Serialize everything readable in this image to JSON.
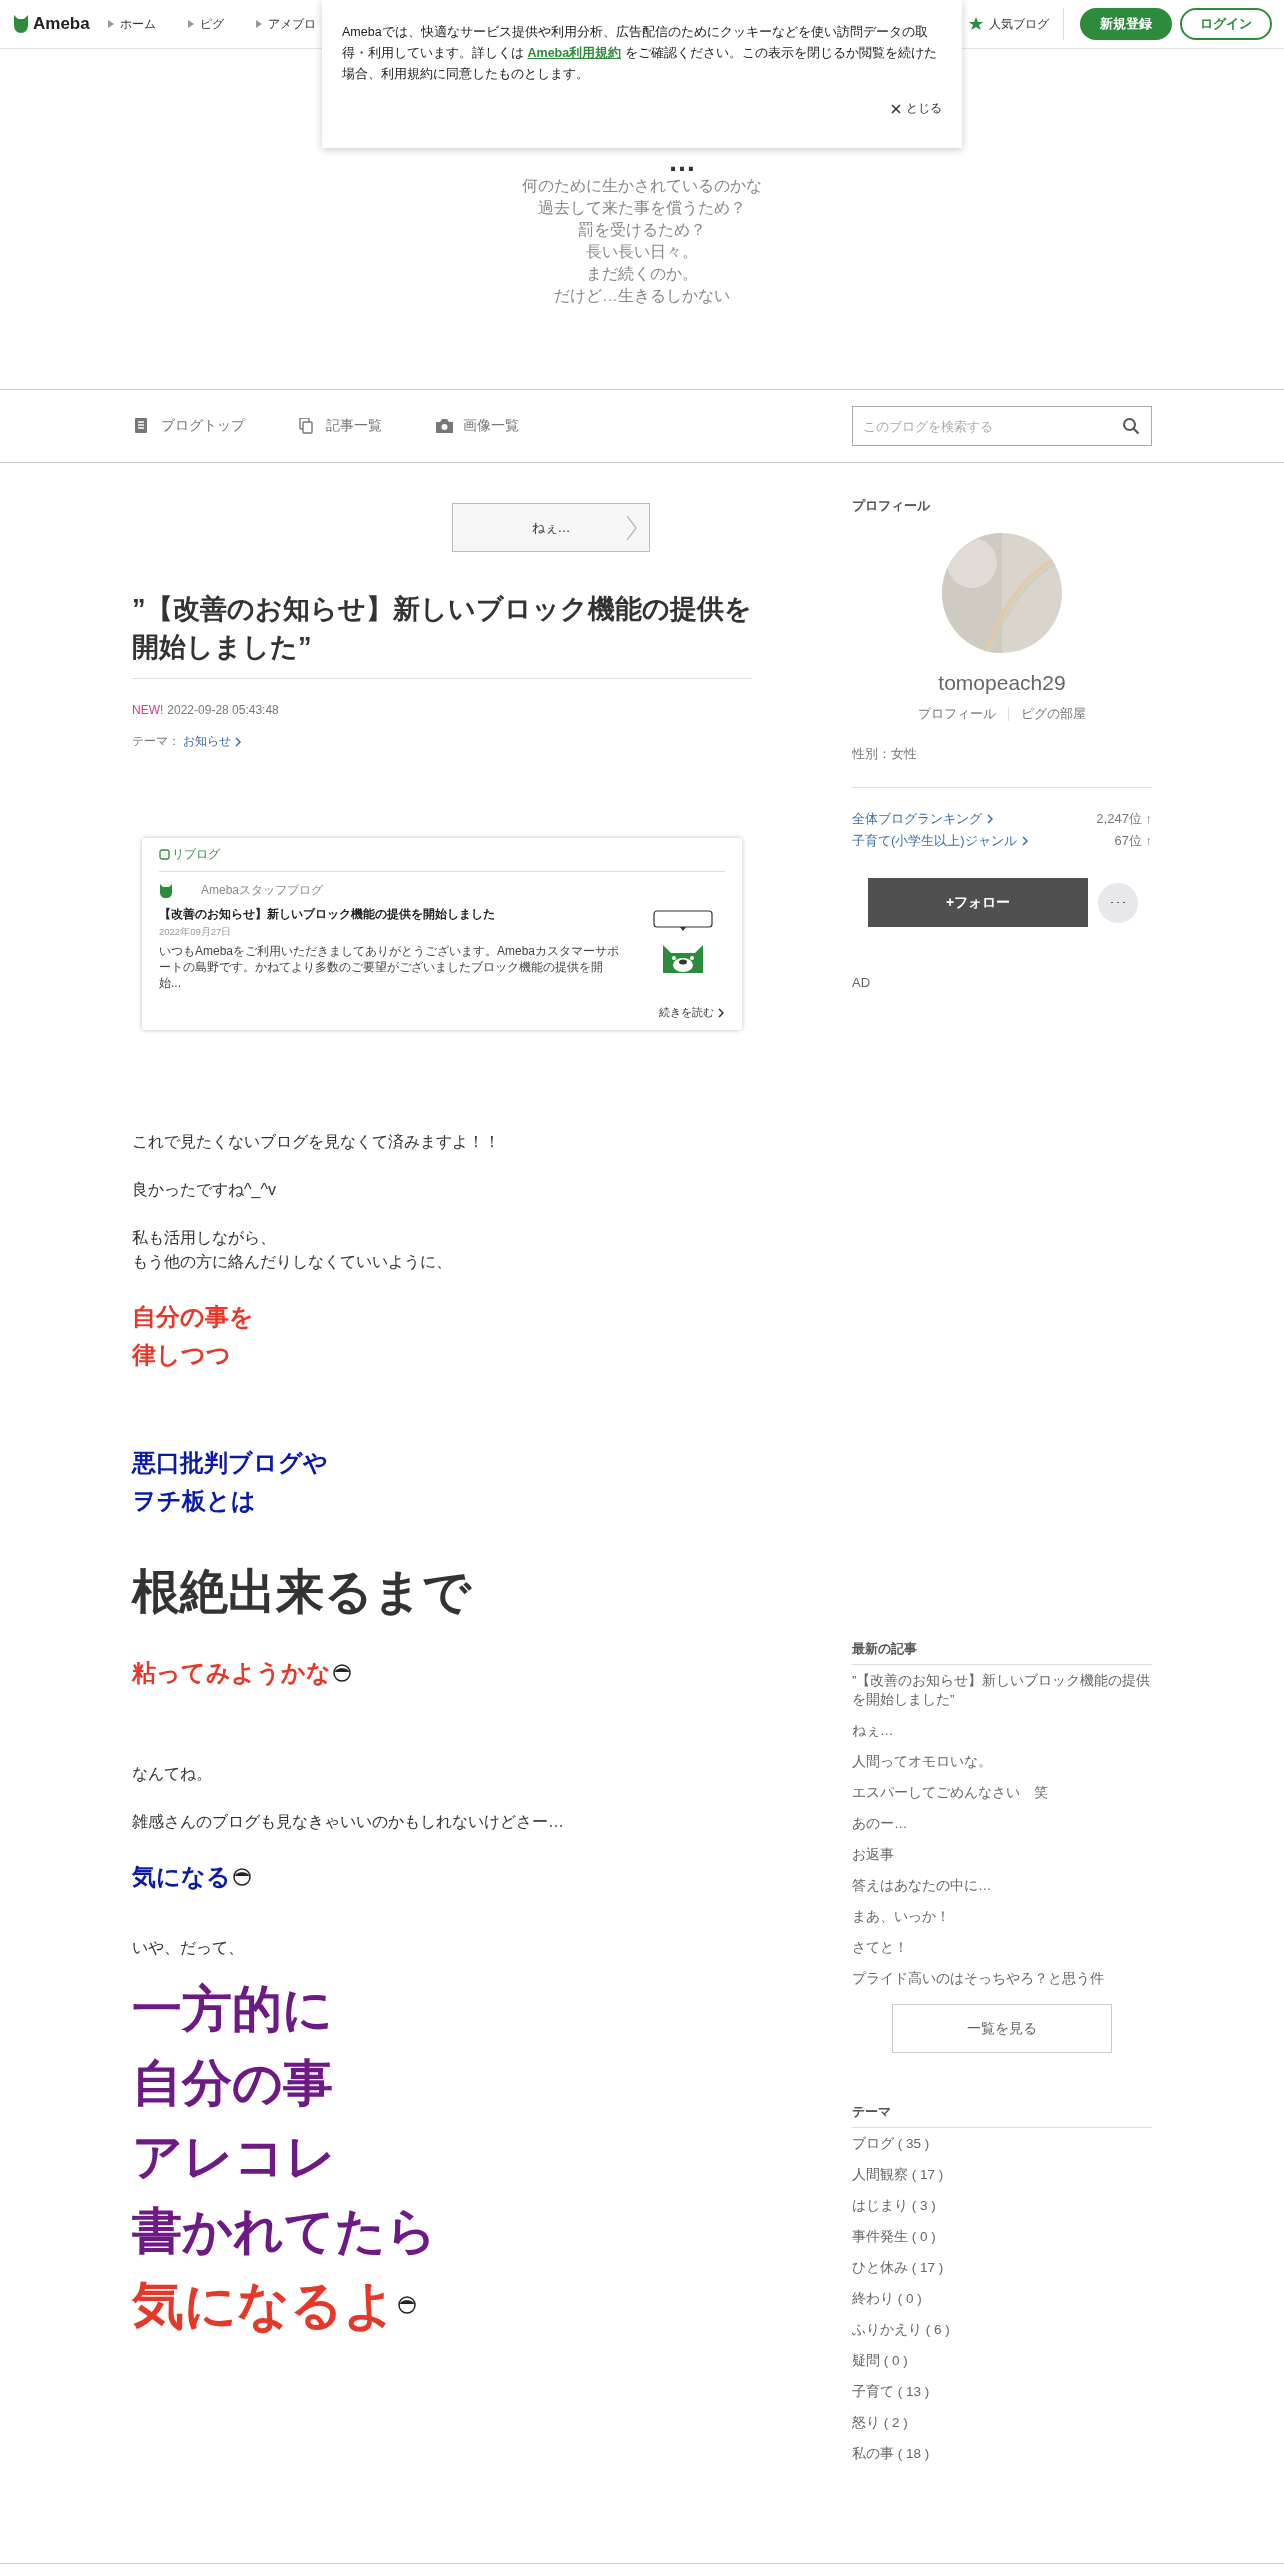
{
  "header": {
    "logo": "Ameba",
    "nav": [
      "ホーム",
      "ピグ",
      "アメブロ"
    ],
    "popular": "人気ブログ",
    "signup": "新規登録",
    "login": "ログイン"
  },
  "cookie_notice": {
    "text_before": "Amebaでは、快適なサービス提供や利用分析、広告配信のためにクッキーなどを使い訪問データの取得・利用しています。詳しくは",
    "link": "Ameba利用規約",
    "text_after": "をご確認ください。この表示を閉じるか閲覧を続けた場合、利用規約に同意したものとします。",
    "close": "とじる"
  },
  "blog": {
    "title": "…",
    "description": [
      "何のために生かされているのかな",
      "過去して来た事を償うため？",
      "罰を受けるため？",
      "長い長い日々。",
      "まだ続くのか。",
      "だけど…生きるしかない"
    ]
  },
  "blog_nav": [
    {
      "kind": "top",
      "label": "ブログトップ"
    },
    {
      "kind": "list",
      "label": "記事一覧"
    },
    {
      "kind": "images",
      "label": "画像一覧"
    }
  ],
  "search": {
    "placeholder": "このブログを検索する"
  },
  "article": {
    "prev": "ねぇ…",
    "title": "”【改善のお知らせ】新しいブロック機能の提供を開始しました”",
    "new_badge": "NEW!",
    "date": "2022-09-28 05:43:48",
    "theme_label": "テーマ：",
    "theme": "お知らせ",
    "reblog": {
      "label": "リブログ",
      "source": "Amebaスタッフブログ",
      "title": "【改善のお知らせ】新しいブロック機能の提供を開始しました",
      "date": "2022年09月27日",
      "excerpt": "いつもAmebaをご利用いただきましてありがとうございます。Amebaカスタマーサポートの島野です。かねてより多数のご要望がございましたブロック機能の提供を開始...",
      "more": "続きを読む"
    },
    "body": [
      {
        "kind": "text",
        "text": "これで見たくないブログを見なくて済みますよ！！"
      },
      {
        "kind": "text",
        "text": "良かったですね^_^v"
      },
      {
        "kind": "text",
        "lines": [
          "私も活用しながら、",
          "もう他の方に絡んだりしなくていいように、"
        ]
      },
      {
        "kind": "red",
        "lines": [
          "自分の事を",
          "律しつつ"
        ]
      },
      {
        "kind": "blue",
        "lines": [
          "悪口批判ブログや",
          "ヲチ板とは"
        ]
      },
      {
        "kind": "huge",
        "text": "根絶出来るまで"
      },
      {
        "kind": "red",
        "text": "粘ってみようかな",
        "emoji": true
      },
      {
        "kind": "text",
        "text": "なんてね。"
      },
      {
        "kind": "text",
        "text": "雑感さんのブログも見なきゃいいのかもしれないけどさー…"
      },
      {
        "kind": "blue",
        "text": "気になる",
        "emoji": true
      },
      {
        "kind": "text",
        "text": "いや、だって、"
      },
      {
        "kind": "purple",
        "text": "一方的に"
      },
      {
        "kind": "purple",
        "text": "自分の事"
      },
      {
        "kind": "purple",
        "text": "アレコレ"
      },
      {
        "kind": "purple",
        "text": "書かれてたら"
      },
      {
        "kind": "red-large",
        "text": "気になるよ",
        "emoji": true
      }
    ]
  },
  "profile": {
    "heading": "プロフィール",
    "name": "tomopeach29",
    "links": [
      "プロフィール",
      "ピグの部屋"
    ],
    "gender": "性別：女性",
    "rankings": [
      {
        "label": "全体ブログランキング",
        "rank": "2,247位 ↑"
      },
      {
        "label": "子育て(小学生以上)ジャンル",
        "rank": "67位 ↑"
      }
    ],
    "follow": "+フォロー",
    "more": "･･･",
    "ad": "AD"
  },
  "latest": {
    "heading": "最新の記事",
    "items": [
      "”【改善のお知らせ】新しいブロック機能の提供を開始しました”",
      "ねぇ…",
      "人間ってオモロいな。",
      "エスパーしてごめんなさい　笑",
      "あのー…",
      "お返事",
      "答えはあなたの中に…",
      "まあ、いっか！",
      "さてと！",
      "プライド高いのはそっちやろ？と思う件"
    ],
    "see_all": "一覧を見る"
  },
  "themes": {
    "heading": "テーマ",
    "items": [
      "ブログ ( 35 )",
      "人間観察 ( 17 )",
      "はじまり ( 3 )",
      "事件発生 ( 0 )",
      "ひと休み ( 17 )",
      "終わり ( 0 )",
      "ふりかえり ( 6 )",
      "疑問 ( 0 )",
      "子育て ( 13 )",
      "怒り ( 2 )",
      "私の事 ( 18 )"
    ]
  }
}
